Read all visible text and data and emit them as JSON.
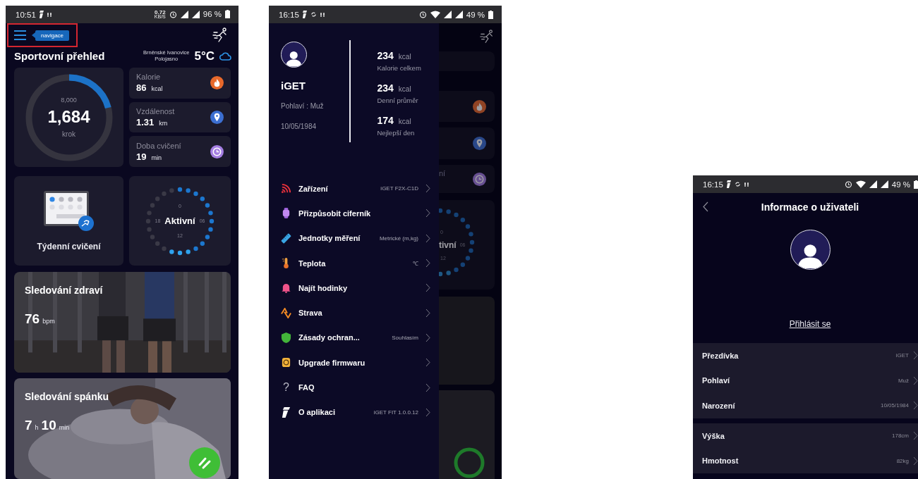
{
  "dashboard": {
    "status_bar": {
      "time": "10:51",
      "speed": "0.72",
      "speed_unit": "KB/S",
      "battery": "96 %"
    },
    "nav_tooltip": "navigace",
    "title": "Sportovní přehled",
    "weather": {
      "location": "Brněnské Ivanovice",
      "condition": "Polojasno",
      "temperature": "5°C"
    },
    "steps": {
      "goal": "8,000",
      "value": "1,684",
      "unit": "krok",
      "level": 0.21
    },
    "metrics": [
      {
        "kind": "calories",
        "label": "Kalorie",
        "value": "86",
        "unit": "kcal"
      },
      {
        "kind": "distance",
        "label": "Vzdálenost",
        "value": "1.31",
        "unit": "km"
      },
      {
        "kind": "duration",
        "label": "Doba cvičení",
        "value": "19",
        "unit": "min"
      }
    ],
    "weekly": {
      "label": "Týdenní cvičení"
    },
    "activity": {
      "label": "Aktivní",
      "ticks": [
        "0",
        "06",
        "12",
        "18"
      ],
      "level": 0.58
    },
    "health": {
      "title": "Sledování zdraví",
      "value": "76",
      "unit": "bpm"
    },
    "sleep": {
      "title": "Sledování spánku",
      "hours": "7",
      "hours_unit": "h",
      "minutes": "10",
      "minutes_unit": "min"
    }
  },
  "menu_screen": {
    "status_bar": {
      "time": "16:15",
      "battery": "49 %"
    },
    "profile": {
      "name": "iGET",
      "gender": "Pohlaví : Muž",
      "birth_date": "10/05/1984"
    },
    "stats": [
      {
        "value": "234",
        "unit": "kcal",
        "label": "Kalorie celkem"
      },
      {
        "value": "234",
        "unit": "kcal",
        "label": "Denní průměr"
      },
      {
        "value": "174",
        "unit": "kcal",
        "label": "Nejlepší den"
      }
    ],
    "menu": [
      {
        "kind": "device",
        "label": "Zařízení",
        "value": "iGET F2X-C1D"
      },
      {
        "kind": "watchface",
        "label": "Přizpůsobit ciferník"
      },
      {
        "kind": "units",
        "label": "Jednotky měření",
        "value": "Metrické (m,kg)"
      },
      {
        "kind": "temperature",
        "label": "Teplota",
        "value": "℃"
      },
      {
        "kind": "find",
        "label": "Najít hodinky"
      },
      {
        "kind": "diet",
        "label": "Strava"
      },
      {
        "kind": "privacy",
        "label": "Zásady ochran...",
        "value": "Souhlasím"
      },
      {
        "kind": "firmware",
        "label": "Upgrade firmwaru"
      },
      {
        "kind": "faq",
        "glyph": "?",
        "label": "FAQ"
      },
      {
        "kind": "about",
        "label": "O aplikaci",
        "value": "iGET FIT 1.0.0.12"
      }
    ],
    "background": {
      "card_label": "ní",
      "ring_label": "tivní",
      "ticks": [
        "0",
        "06",
        "12"
      ]
    }
  },
  "user_info": {
    "status_bar": {
      "time": "16:15",
      "battery": "49 %"
    },
    "title": "Informace o uživateli",
    "login_link": "Přihlásit se",
    "groups": [
      [
        {
          "label": "Přezdívka",
          "value": "iGET"
        },
        {
          "label": "Pohlaví",
          "value": "Muž"
        },
        {
          "label": "Narození",
          "value": "10/05/1984"
        }
      ],
      [
        {
          "label": "Výška",
          "value": "178cm"
        },
        {
          "label": "Hmotnost",
          "value": "82kg"
        }
      ]
    ]
  }
}
